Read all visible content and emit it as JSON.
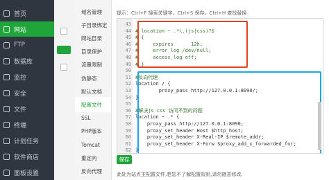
{
  "sidebar": {
    "items": [
      {
        "label": "首页",
        "icon": "home-icon",
        "active": false
      },
      {
        "label": "网站",
        "icon": "globe-icon",
        "active": true
      },
      {
        "label": "FTP",
        "icon": "ftp-icon",
        "active": false
      },
      {
        "label": "数据库",
        "icon": "database-icon",
        "active": false
      },
      {
        "label": "监控",
        "icon": "monitor-icon",
        "active": false
      },
      {
        "label": "安全",
        "icon": "shield-icon",
        "active": false
      },
      {
        "label": "文件",
        "icon": "folder-icon",
        "active": false
      },
      {
        "label": "终端",
        "icon": "terminal-icon",
        "active": false
      },
      {
        "label": "计划任务",
        "icon": "clock-icon",
        "active": false
      },
      {
        "label": "软件商店",
        "icon": "store-icon",
        "active": false
      },
      {
        "label": "面板设置",
        "icon": "gear-icon",
        "active": false
      }
    ]
  },
  "modal": {
    "tabs": [
      {
        "label": "域名管理",
        "active": false
      },
      {
        "label": "子目录绑定",
        "active": false
      },
      {
        "label": "网站目录",
        "active": false
      },
      {
        "label": "目录保护",
        "active": false
      },
      {
        "label": "流量限制",
        "active": false
      },
      {
        "label": "伪静态",
        "active": false
      },
      {
        "label": "默认文档",
        "active": false
      },
      {
        "label": "配置文件",
        "active": true
      },
      {
        "label": "SSL",
        "active": false
      },
      {
        "label": "PHP版本",
        "active": false
      },
      {
        "label": "Tomcat",
        "active": false
      },
      {
        "label": "重定向",
        "active": false
      },
      {
        "label": "反向代理",
        "active": false
      }
    ],
    "hint": "提示：Ctrl+F 搜索关键字，Ctrl+S 保存，Ctrl+H 查找替换",
    "editor": {
      "lines": [
        {
          "num": "43",
          "text": ""
        },
        {
          "num": "44",
          "text": "# location ~ .*\\.(js|css)?$"
        },
        {
          "num": "45",
          "text": "# {"
        },
        {
          "num": "46",
          "text": "#     expires      12h;"
        },
        {
          "num": "47",
          "text": "#     error_log /dev/null;"
        },
        {
          "num": "48",
          "text": "#     access_log off;"
        },
        {
          "num": "49",
          "text": "# }"
        },
        {
          "num": "50",
          "text": ""
        },
        {
          "num": "51",
          "text": "#反向代理"
        },
        {
          "num": "52",
          "text": "location / {"
        },
        {
          "num": "53",
          "text": "        proxy_pass http://127.0.0.1:8090/;"
        },
        {
          "num": "54",
          "text": "}"
        },
        {
          "num": "55",
          "text": ""
        },
        {
          "num": "56",
          "text": "#解决js css 访问不到的问题"
        },
        {
          "num": "57",
          "text": "location ~ .* {"
        },
        {
          "num": "58",
          "text": "    proxy_pass http://127.0.0.1:8090;"
        },
        {
          "num": "59",
          "text": "    proxy_set_header Host $http_host;"
        },
        {
          "num": "60",
          "text": "    proxy_set_header X-Real-IP $remote_addr;"
        },
        {
          "num": "61",
          "text": "    proxy_set_header X-Forw $proxy_add_x_forwarded_for;"
        },
        {
          "num": "62",
          "text": "}"
        }
      ]
    },
    "save_label": "保存",
    "note": "此处为站点主配置文件,若您不了解配置规则,请勿随意修改."
  },
  "colors": {
    "accent": "#20a53a",
    "red_box": "#e1431f",
    "blue_box": "#1aa7e6",
    "sidebar_bg": "#2f3640"
  }
}
